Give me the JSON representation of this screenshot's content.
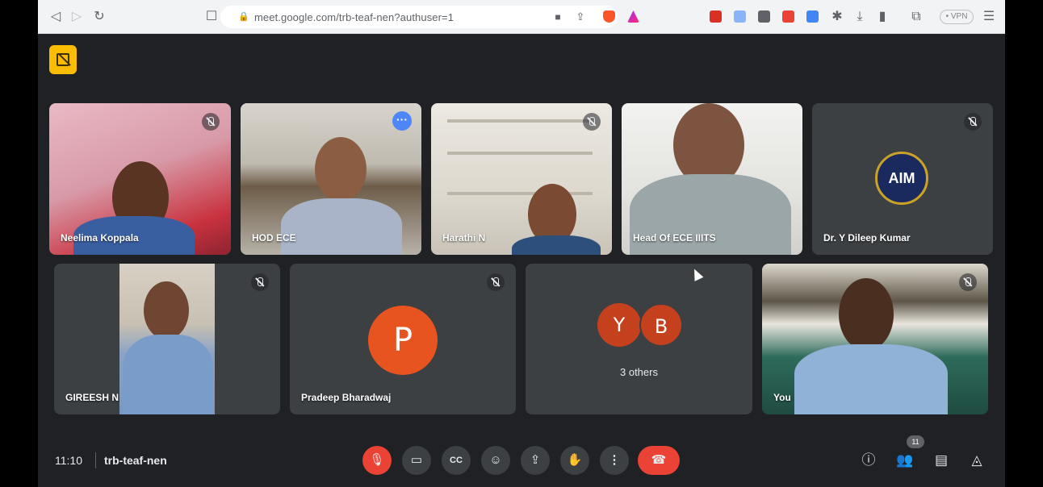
{
  "browser": {
    "url": "meet.google.com/trb-teaf-nen?authuser=1",
    "vpn_label": "• VPN"
  },
  "participants": [
    {
      "name": "Neelima Koppala"
    },
    {
      "name": "HOD ECE"
    },
    {
      "name": "Harathi N"
    },
    {
      "name": "Head Of ECE IIITS"
    },
    {
      "name": "Dr. Y Dileep Kumar",
      "logo_text": "AIM"
    },
    {
      "name": "GIREESH N"
    },
    {
      "name": "Pradeep Bharadwaj",
      "avatar_letter": "P",
      "avatar_color": "#e8541f"
    },
    {
      "others_label": "3 others",
      "avatars": [
        "Y",
        "B"
      ],
      "avatar_color": "#c5401c"
    },
    {
      "name": "You"
    }
  ],
  "meeting": {
    "time": "11:10",
    "code": "trb-teaf-nen",
    "participant_count": "11"
  },
  "colors": {
    "accent": "#8ab4f8",
    "danger": "#ea4335",
    "tile_bg": "#3c4043",
    "page_bg": "#202124"
  }
}
